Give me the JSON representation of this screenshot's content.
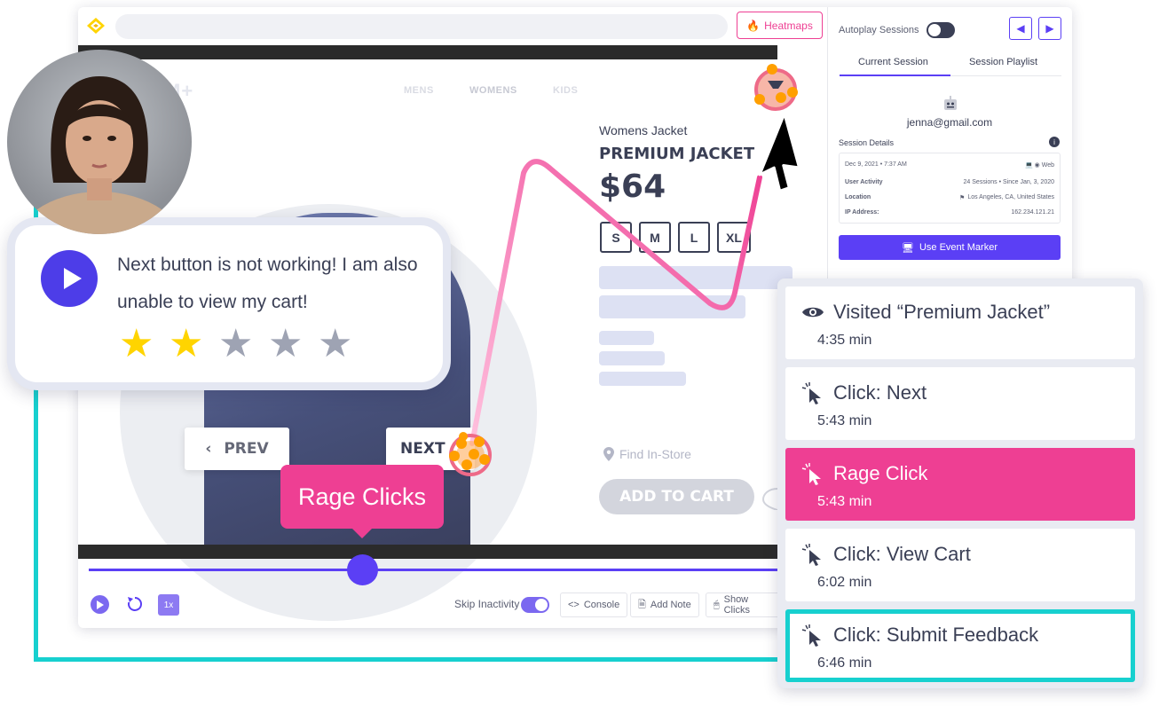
{
  "toolbar": {
    "heatmaps_label": "Heatmaps"
  },
  "store": {
    "nav": [
      "MENS",
      "WOMENS",
      "KIDS"
    ],
    "product_subtitle": "Womens Jacket",
    "product_title": "PREMIUM JACKET",
    "price": "$64",
    "sizes": [
      "S",
      "M",
      "L",
      "XL"
    ],
    "find_store": "Find In-Store",
    "add_to_cart": "ADD TO CART",
    "prev_label": "PREV",
    "next_label": "NEXT"
  },
  "tooltip": {
    "rage_clicks": "Rage Clicks"
  },
  "playback": {
    "speed": "1x",
    "skip_inactivity": "Skip Inactivity",
    "console": "Console",
    "add_note": "Add Note",
    "show_clicks": "Show Clicks"
  },
  "panel": {
    "autoplay": "Autoplay Sessions",
    "tabs": [
      "Current Session",
      "Session Playlist"
    ],
    "email": "jenna@gmail.com",
    "session_details_title": "Session Details",
    "details": [
      {
        "label": "Dec 9, 2021 • 7:37 AM",
        "value": "Web"
      },
      {
        "label": "User Activity",
        "value": "24 Sessions • Since Jan, 3, 2020"
      },
      {
        "label": "Location",
        "value": "Los Angeles, CA, United States"
      },
      {
        "label": "IP Address:",
        "value": "162.234.121.21"
      }
    ],
    "event_marker": "Use Event Marker"
  },
  "events": [
    {
      "title": "Visited “Premium Jacket”",
      "time": "4:35 min",
      "icon": "eye-icon"
    },
    {
      "title": "Click: Next",
      "time": "5:43 min",
      "icon": "cursor-click-icon"
    },
    {
      "title": "Rage Click",
      "time": "5:43 min",
      "icon": "cursor-click-icon"
    },
    {
      "title": "Click: View Cart",
      "time": "6:02 min",
      "icon": "cursor-click-icon"
    },
    {
      "title": "Click: Submit Feedback",
      "time": "6:46 min",
      "icon": "cursor-click-icon"
    }
  ],
  "feedback": {
    "message": "Next button is not working! I am also unable to view my cart!",
    "rating": 2,
    "max_rating": 5
  },
  "colors": {
    "accent": "#5b3ff5",
    "rage": "#ee3f93",
    "teal": "#17d0cf",
    "star": "#ffd400",
    "star_off": "#9ea3b3"
  }
}
